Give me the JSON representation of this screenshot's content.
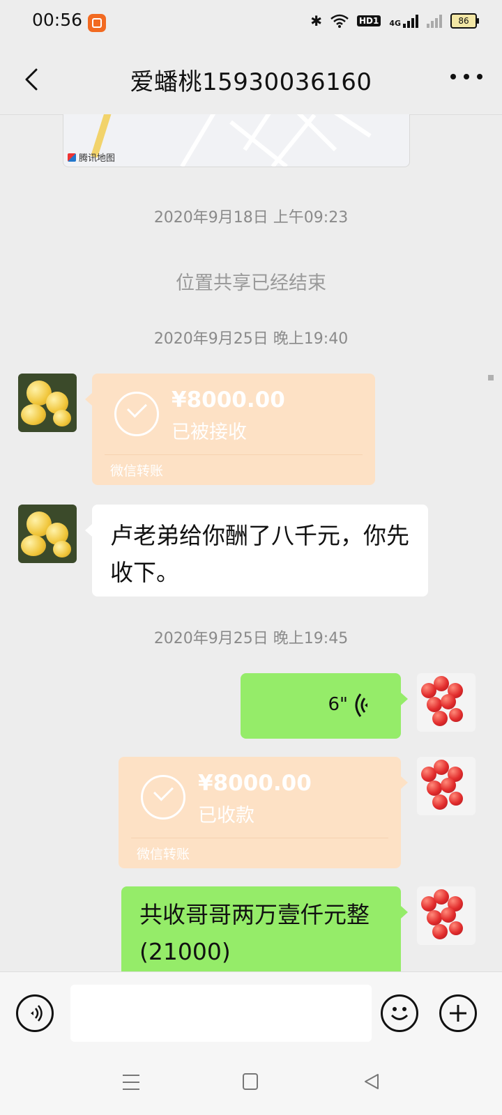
{
  "status_bar": {
    "time": "00:56",
    "hd_label": "HD1",
    "network": "4G",
    "battery": "86"
  },
  "header": {
    "title": "爱蟠桃15930036160"
  },
  "map_card": {
    "brand": "腾讯地图"
  },
  "messages": {
    "ts1": "2020年9月18日 上午09:23",
    "system1": "位置共享已经结束",
    "ts2": "2020年9月25日 晚上19:40",
    "transfer1": {
      "amount": "¥8000.00",
      "status": "已被接收",
      "label": "微信转账"
    },
    "text1": "卢老弟给你酬了八千元，你先收下。",
    "ts3": "2020年9月25日 晚上19:45",
    "voice1": {
      "duration": "6\""
    },
    "transfer2": {
      "amount": "¥8000.00",
      "status": "已收款",
      "label": "微信转账"
    },
    "text2": "共收哥哥两万壹仟元整(21000)"
  },
  "colors": {
    "background": "#ededed",
    "bubble_green": "#95ec69",
    "bubble_white": "#ffffff",
    "transfer_orange": "#fde1c5",
    "timestamp_gray": "#8a8a8a"
  },
  "icons": {
    "back": "back-arrow-icon",
    "more": "more-dots-icon",
    "voice_toggle": "voice-toggle-icon",
    "emoji": "emoji-icon",
    "plus": "plus-icon",
    "check": "check-circle-icon",
    "voice_wave": "voice-wave-icon"
  }
}
